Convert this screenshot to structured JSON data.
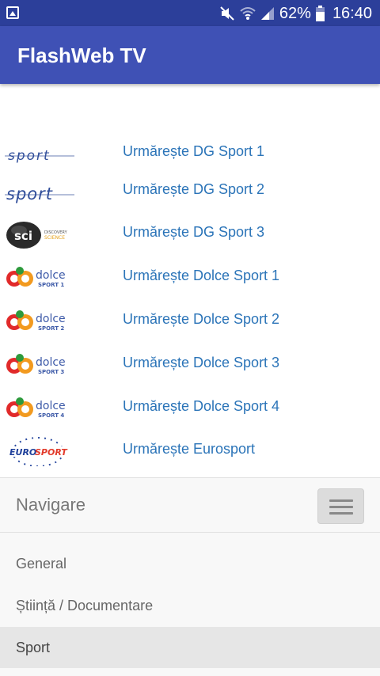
{
  "status_bar": {
    "battery_percent": "62%",
    "time": "16:40",
    "icons": [
      "gallery-icon",
      "mute-icon",
      "wifi-icon",
      "signal-icon",
      "battery-icon"
    ]
  },
  "app_bar": {
    "title": "FlashWeb TV",
    "color": "#3f51b5"
  },
  "channels": [
    {
      "label": "Urmărește DG Sport 1",
      "logo": "sport-logo-icon"
    },
    {
      "label": "Urmărește DG Sport 2",
      "logo": "sport-logo-icon"
    },
    {
      "label": "Urmărește DG Sport 3",
      "logo": "sci-discovery-science-logo-icon"
    },
    {
      "label": "Urmărește Dolce Sport 1",
      "logo": "dolce-sport-1-logo-icon",
      "logo_caption": "SPORT 1"
    },
    {
      "label": "Urmărește Dolce Sport 2",
      "logo": "dolce-sport-2-logo-icon",
      "logo_caption": "SPORT 2"
    },
    {
      "label": "Urmărește Dolce Sport 3",
      "logo": "dolce-sport-3-logo-icon",
      "logo_caption": "SPORT 3"
    },
    {
      "label": "Urmărește Dolce Sport 4",
      "logo": "dolce-sport-4-logo-icon",
      "logo_caption": "SPORT 4"
    },
    {
      "label": "Urmărește Eurosport",
      "logo": "eurosport-logo-icon"
    }
  ],
  "navigation": {
    "heading": "Navigare",
    "toggle_icon": "hamburger-menu-icon",
    "items": [
      {
        "label": "General",
        "active": false
      },
      {
        "label": "Știință / Documentare",
        "active": false
      },
      {
        "label": "Sport",
        "active": true
      }
    ]
  },
  "colors": {
    "link": "#2b74b8",
    "status_bar": "#2c3f9a"
  }
}
